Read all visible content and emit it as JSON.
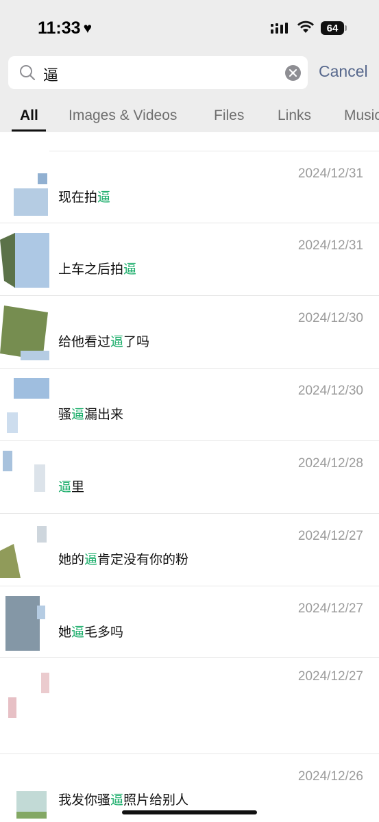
{
  "status_bar": {
    "time": "11:33",
    "battery": "64"
  },
  "search": {
    "query": "逼",
    "cancel_label": "Cancel"
  },
  "tabs": [
    {
      "label": "All",
      "active": true
    },
    {
      "label": "Images & Videos",
      "active": false
    },
    {
      "label": "Files",
      "active": false
    },
    {
      "label": "Links",
      "active": false
    },
    {
      "label": "Music",
      "active": false
    }
  ],
  "results": [
    {
      "date": "2024/12/31",
      "before": "现在拍",
      "highlight": "逼",
      "after": ""
    },
    {
      "date": "2024/12/31",
      "before": "上车之后拍",
      "highlight": "逼",
      "after": ""
    },
    {
      "date": "2024/12/30",
      "before": "给他看过",
      "highlight": "逼",
      "after": "了吗"
    },
    {
      "date": "2024/12/30",
      "before": "骚",
      "highlight": "逼",
      "after": "漏出来"
    },
    {
      "date": "2024/12/28",
      "before": "",
      "highlight": "逼",
      "after": "里"
    },
    {
      "date": "2024/12/27",
      "before": "她的",
      "highlight": "逼",
      "after": "肯定没有你的粉"
    },
    {
      "date": "2024/12/27",
      "before": "她",
      "highlight": "逼",
      "after": "毛多吗"
    },
    {
      "date": "2024/12/27",
      "before": "",
      "highlight": "",
      "after": ""
    },
    {
      "date": "2024/12/26",
      "before": "我发你骚",
      "highlight": "逼",
      "after": "照片给别人"
    }
  ],
  "colors": {
    "highlight": "#1aad6a",
    "cancel": "#56678c",
    "header_bg": "#ededed"
  }
}
